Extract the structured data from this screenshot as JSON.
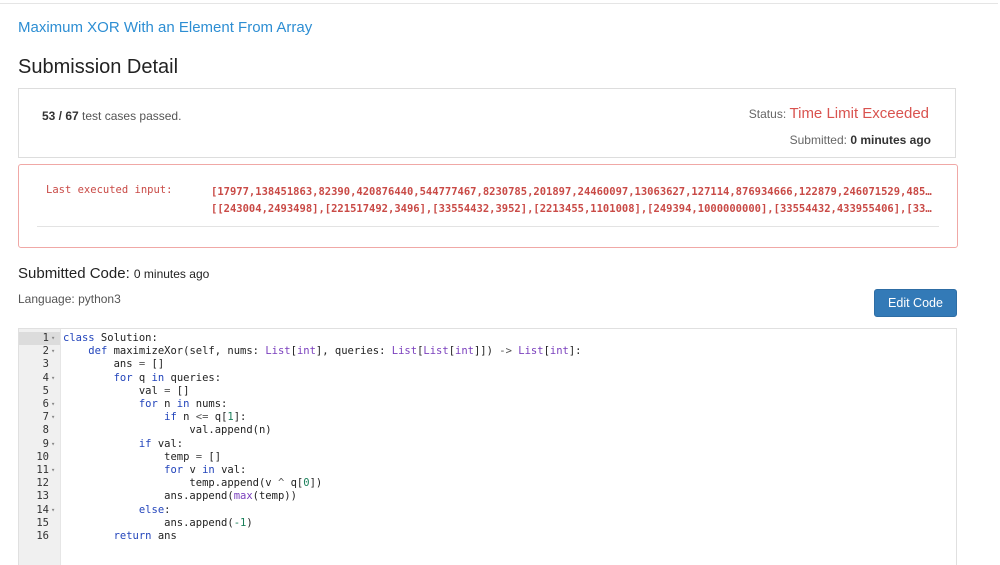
{
  "problem_title": "Maximum XOR With an Element From Array",
  "page_title": "Submission Detail",
  "summary": {
    "passed_count": "53 / 67",
    "passed_suffix": "test cases passed.",
    "status_label": "Status:",
    "status_value": "Time Limit Exceeded",
    "submitted_label": "Submitted:",
    "submitted_value": "0 minutes ago"
  },
  "error": {
    "label": "Last executed input:",
    "line1": "[17977,138451863,82390,420876440,544777467,8230785,201897,24460097,13063627,127114,876934666,122879,246071529,485…",
    "line2": "[[243004,2493498],[221517492,3496],[33554432,3952],[2213455,1101008],[249394,1000000000],[33554432,433955406],[33…"
  },
  "code_section": {
    "heading": "Submitted Code:",
    "heading_time": "0 minutes ago",
    "language_label": "Language:",
    "language": "python3",
    "edit_button": "Edit Code"
  },
  "colors": {
    "link": "#2d8ed3",
    "status_error": "#d9534f",
    "button": "#337ab7"
  },
  "code_lines": [
    {
      "n": "1",
      "fold": true
    },
    {
      "n": "2",
      "fold": true
    },
    {
      "n": "3",
      "fold": false
    },
    {
      "n": "4",
      "fold": true
    },
    {
      "n": "5",
      "fold": false
    },
    {
      "n": "6",
      "fold": true
    },
    {
      "n": "7",
      "fold": true
    },
    {
      "n": "8",
      "fold": false
    },
    {
      "n": "9",
      "fold": true
    },
    {
      "n": "10",
      "fold": false
    },
    {
      "n": "11",
      "fold": true
    },
    {
      "n": "12",
      "fold": false
    },
    {
      "n": "13",
      "fold": false
    },
    {
      "n": "14",
      "fold": true
    },
    {
      "n": "15",
      "fold": false
    },
    {
      "n": "16",
      "fold": false
    }
  ],
  "code_text": [
    "class Solution:",
    "    def maximizeXor(self, nums: List[int], queries: List[List[int]]) -> List[int]:",
    "        ans = []",
    "        for q in queries:",
    "            val = []",
    "            for n in nums:",
    "                if n <= q[1]:",
    "                    val.append(n)",
    "            if val:",
    "                temp = []",
    "                for v in val:",
    "                    temp.append(v ^ q[0])",
    "                ans.append(max(temp))",
    "            else:",
    "                ans.append(-1)",
    "        return ans"
  ]
}
